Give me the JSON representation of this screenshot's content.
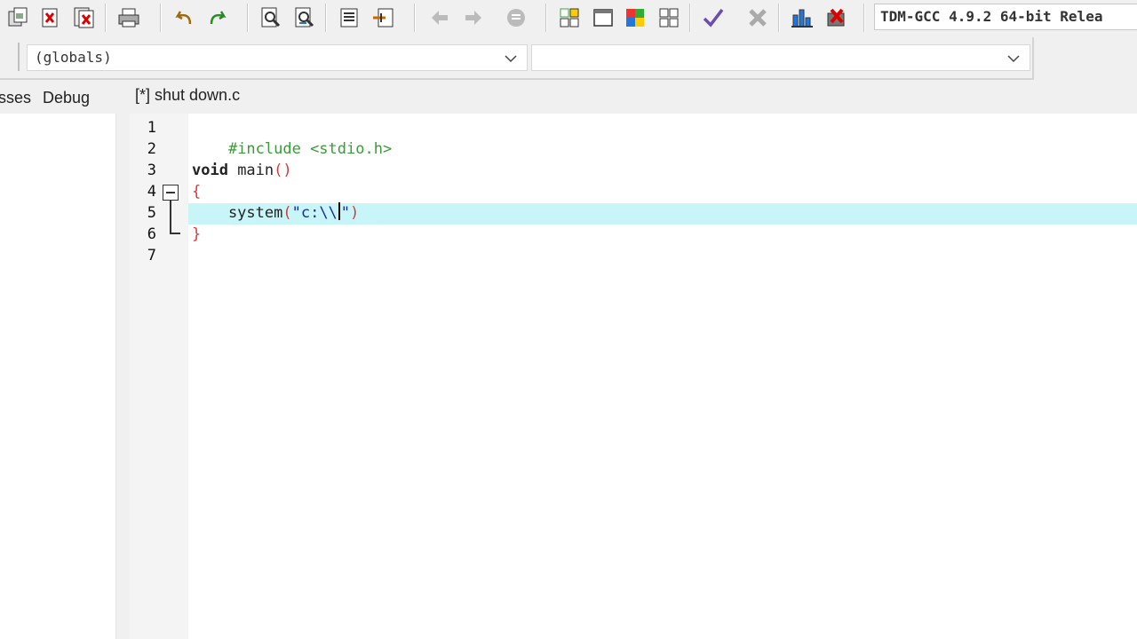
{
  "toolbar": {
    "compiler": "TDM-GCC 4.9.2 64-bit Relea",
    "buttons": [
      "new-icon",
      "close-icon",
      "close-all-icon",
      "print-icon",
      "undo-icon",
      "redo-icon",
      "find-icon",
      "replace-icon",
      "indent-icon",
      "unindent-icon",
      "back-icon",
      "forward-icon",
      "bookmark-icon",
      "grid-icon",
      "window-icon",
      "color-grid-icon",
      "tile-icon",
      "check-icon",
      "delete-icon",
      "chart-icon",
      "stop-icon"
    ]
  },
  "classbar": {
    "scope_value": "(globals)",
    "member_value": ""
  },
  "tabs": {
    "left_partial": "sses",
    "debug": "Debug",
    "editor_file": "[*] shut down.c"
  },
  "editor": {
    "line_numbers": [
      "1",
      "2",
      "3",
      "4",
      "5",
      "6",
      "7"
    ],
    "lines": {
      "l1": "#include <stdio.h>",
      "l3_kw": "void",
      "l3_rest": " main",
      "l3_paren": "()",
      "l4": "{",
      "l5_fn": "    system",
      "l5_open": "(",
      "l5_str_a": "\"c:\\\\",
      "l5_str_b": "\"",
      "l5_close": ")",
      "l6": "}"
    }
  },
  "colors": {
    "active_line": "#c8f5f8",
    "preprocessor": "#3c9a3c",
    "brace": "#d23c3c",
    "string": "#1a2aa0"
  }
}
